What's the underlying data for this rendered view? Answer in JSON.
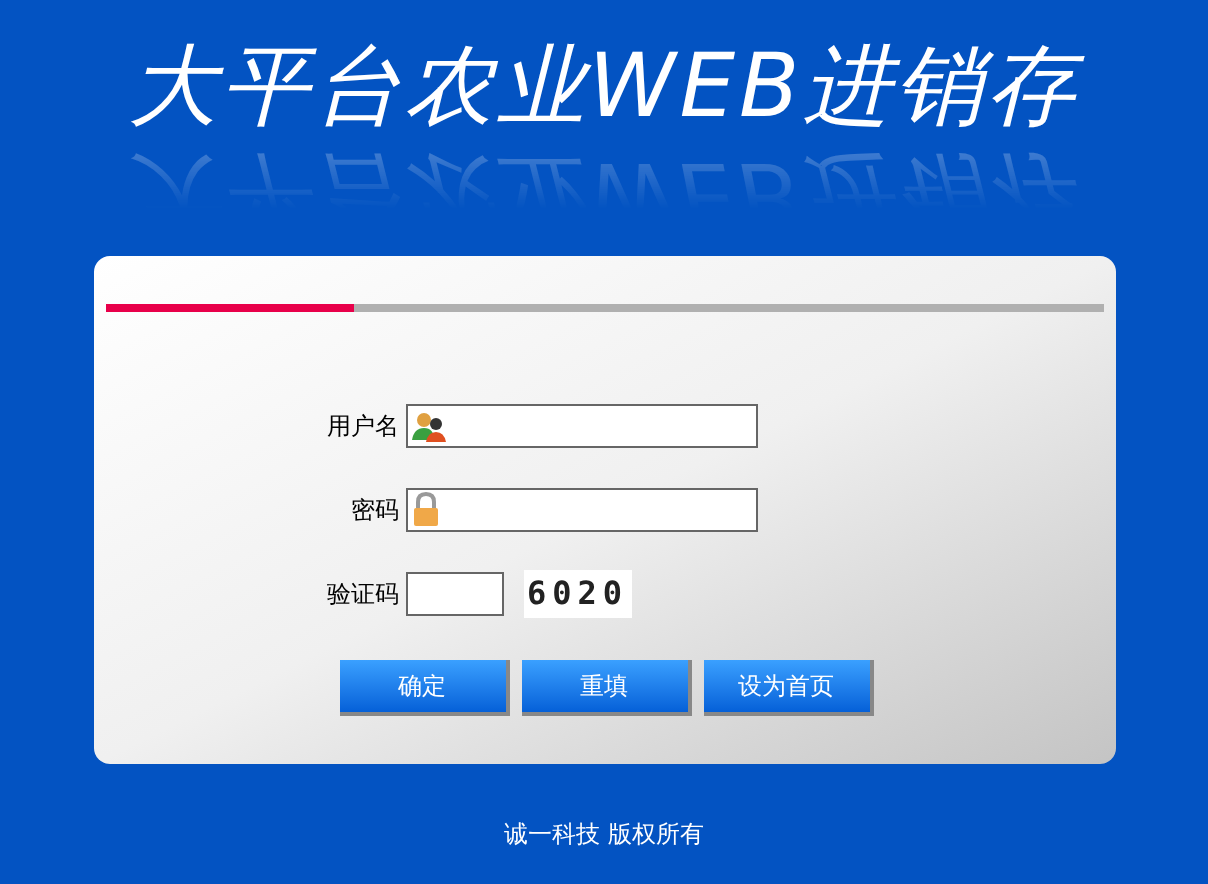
{
  "title": "大平台农业WEB进销存",
  "progress": {
    "level": 0.25
  },
  "fields": [
    {
      "kind": "user",
      "label": "用户名"
    },
    {
      "kind": "password",
      "label": "密码"
    },
    {
      "kind": "captcha",
      "label": "验证码",
      "code": "6020"
    }
  ],
  "buttons": [
    "确定",
    "重填",
    "设为首页"
  ],
  "footer": "诚一科技 版权所有"
}
